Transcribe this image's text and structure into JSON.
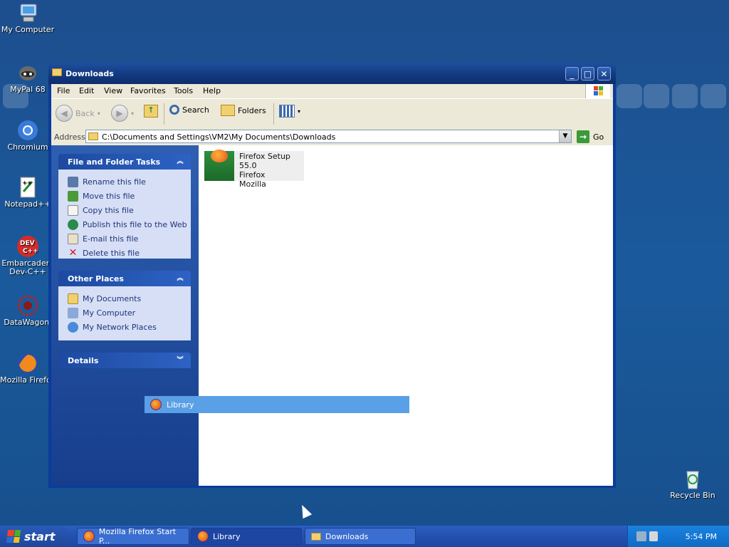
{
  "desktop": {
    "icons": [
      {
        "label": "My Computer"
      },
      {
        "label": "MyPal 68"
      },
      {
        "label": "Chromium"
      },
      {
        "label": "Notepad++"
      },
      {
        "label": "Embarcadero Dev-C++"
      },
      {
        "label": "DataWagon."
      },
      {
        "label": "Mozilla Firefox"
      },
      {
        "label": "Recycle Bin"
      }
    ]
  },
  "window": {
    "title": "Downloads",
    "menu": [
      "File",
      "Edit",
      "View",
      "Favorites",
      "Tools",
      "Help"
    ],
    "toolbar": {
      "back_label": "Back",
      "search_label": "Search",
      "folders_label": "Folders"
    },
    "address": {
      "label": "Address",
      "value": "C:\\Documents and Settings\\VM2\\My Documents\\Downloads",
      "go_label": "Go"
    },
    "file_tasks": {
      "title": "File and Folder Tasks",
      "items": [
        {
          "label": "Rename this file"
        },
        {
          "label": "Move this file"
        },
        {
          "label": "Copy this file"
        },
        {
          "label": "Publish this file to the Web"
        },
        {
          "label": "E-mail this file"
        },
        {
          "label": "Delete this file"
        }
      ]
    },
    "other_places": {
      "title": "Other Places",
      "items": [
        {
          "label": "My Documents"
        },
        {
          "label": "My Computer"
        },
        {
          "label": "My Network Places"
        }
      ]
    },
    "details": {
      "title": "Details"
    },
    "files": [
      {
        "name": "Firefox Setup 55.0",
        "type": "Firefox",
        "company": "Mozilla"
      }
    ]
  },
  "drag_popup": {
    "label": "Library"
  },
  "taskbar": {
    "start_label": "start",
    "items": [
      {
        "label": "Mozilla Firefox Start P..."
      },
      {
        "label": "Library"
      },
      {
        "label": "Downloads"
      }
    ],
    "clock": "5:54 PM"
  },
  "colors": {
    "desktop": "#1a5a9c",
    "window_frame": "#0b3b9a",
    "selection": "#5aa0e6",
    "taskbar": "#2251b0"
  }
}
